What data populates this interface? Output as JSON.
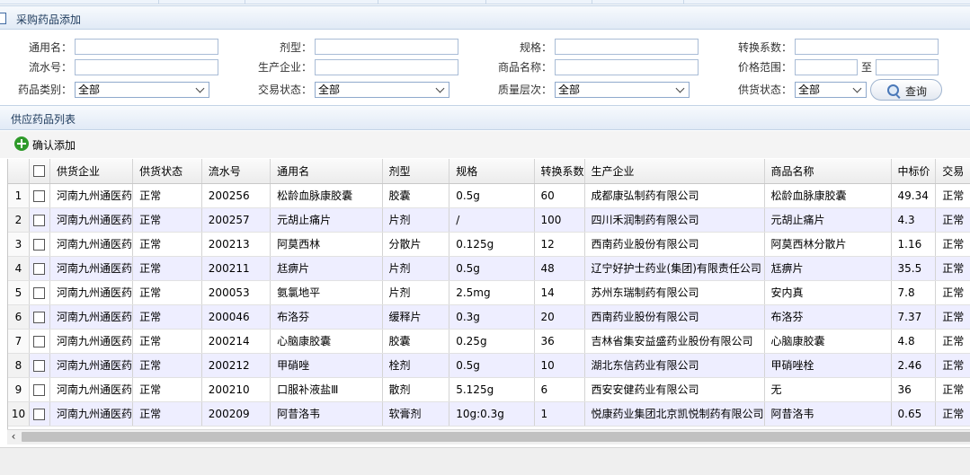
{
  "header": {
    "title": "采购药品添加"
  },
  "form": {
    "row1": [
      {
        "label": "通用名：",
        "value": ""
      },
      {
        "label": "剂型：",
        "value": ""
      },
      {
        "label": "规格：",
        "value": ""
      },
      {
        "label": "转换系数：",
        "value": ""
      }
    ],
    "row2": [
      {
        "label": "流水号：",
        "value": ""
      },
      {
        "label": "生产企业：",
        "value": ""
      },
      {
        "label": "商品名称：",
        "value": ""
      },
      {
        "label": "价格范围：",
        "value": ""
      }
    ],
    "price_to_label": "至",
    "price_to_value": "",
    "row3": [
      {
        "label": "药品类别：",
        "selected": "全部"
      },
      {
        "label": "交易状态：",
        "selected": "全部"
      },
      {
        "label": "质量层次：",
        "selected": "全部"
      },
      {
        "label": "供货状态：",
        "selected": "全部"
      }
    ],
    "query_label": "查询"
  },
  "list": {
    "title": "供应药品列表",
    "add_label": "确认添加",
    "columns": [
      "供货企业",
      "供货状态",
      "流水号",
      "通用名",
      "剂型",
      "规格",
      "转换系数",
      "生产企业",
      "商品名称",
      "中标价",
      "交易"
    ],
    "rows": [
      {
        "n": "1",
        "cells": [
          "河南九州通医药",
          "正常",
          "200256",
          "松龄血脉康胶囊",
          "胶囊",
          "0.5g",
          "60",
          "成都康弘制药有限公司",
          "松龄血脉康胶囊",
          "49.34",
          "正常"
        ]
      },
      {
        "n": "2",
        "cells": [
          "河南九州通医药",
          "正常",
          "200257",
          "元胡止痛片",
          "片剂",
          "/",
          "100",
          "四川禾润制药有限公司",
          "元胡止痛片",
          "4.3",
          "正常"
        ]
      },
      {
        "n": "3",
        "cells": [
          "河南九州通医药",
          "正常",
          "200213",
          "阿莫西林",
          "分散片",
          "0.125g",
          "12",
          "西南药业股份有限公司",
          "阿莫西林分散片",
          "1.16",
          "正常"
        ]
      },
      {
        "n": "4",
        "cells": [
          "河南九州通医药",
          "正常",
          "200211",
          "尪痹片",
          "片剂",
          "0.5g",
          "48",
          "辽宁好护士药业(集团)有限责任公司",
          "尪痹片",
          "35.5",
          "正常"
        ]
      },
      {
        "n": "5",
        "cells": [
          "河南九州通医药",
          "正常",
          "200053",
          "氨氯地平",
          "片剂",
          "2.5mg",
          "14",
          "苏州东瑞制药有限公司",
          "安内真",
          "7.8",
          "正常"
        ]
      },
      {
        "n": "6",
        "cells": [
          "河南九州通医药",
          "正常",
          "200046",
          "布洛芬",
          "缓释片",
          "0.3g",
          "20",
          "西南药业股份有限公司",
          "布洛芬",
          "7.37",
          "正常"
        ]
      },
      {
        "n": "7",
        "cells": [
          "河南九州通医药",
          "正常",
          "200214",
          "心脑康胶囊",
          "胶囊",
          "0.25g",
          "36",
          "吉林省集安益盛药业股份有限公司",
          "心脑康胶囊",
          "4.8",
          "正常"
        ]
      },
      {
        "n": "8",
        "cells": [
          "河南九州通医药",
          "正常",
          "200212",
          "甲硝唑",
          "栓剂",
          "0.5g",
          "10",
          "湖北东信药业有限公司",
          "甲硝唑栓",
          "2.46",
          "正常"
        ]
      },
      {
        "n": "9",
        "cells": [
          "河南九州通医药",
          "正常",
          "200210",
          "口服补液盐Ⅲ",
          "散剂",
          "5.125g",
          "6",
          "西安安健药业有限公司",
          "无",
          "36",
          "正常"
        ]
      },
      {
        "n": "10",
        "cells": [
          "河南九州通医药",
          "正常",
          "200209",
          "阿昔洛韦",
          "软膏剂",
          "10g:0.3g",
          "1",
          "悦康药业集团北京凯悦制药有限公司",
          "阿昔洛韦",
          "0.65",
          "正常"
        ]
      }
    ]
  },
  "icons": {
    "add": "plus-circle-icon",
    "query": "magnifier-icon",
    "scroll_left": "chevron-left-icon"
  }
}
